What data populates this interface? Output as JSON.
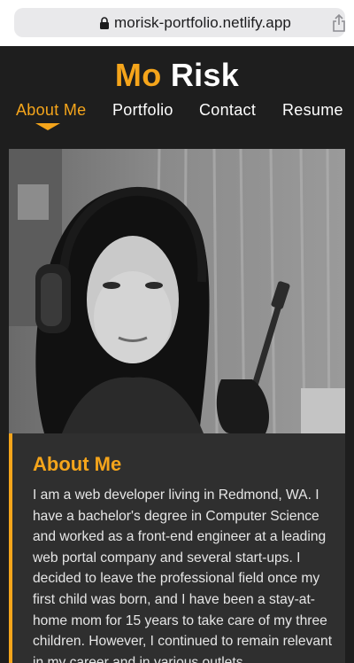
{
  "browser": {
    "url": "morisk-portfolio.netlify.app",
    "icons": [
      "lock-icon",
      "share-icon"
    ]
  },
  "site": {
    "title_first": "Mo",
    "title_last": "Risk",
    "accent_color": "#f5a51b",
    "background_color": "#1e1e1e"
  },
  "nav": {
    "items": [
      {
        "label": "About Me",
        "active": true
      },
      {
        "label": "Portfolio",
        "active": false
      },
      {
        "label": "Contact",
        "active": false
      },
      {
        "label": "Resume",
        "active": false
      }
    ]
  },
  "about": {
    "heading": "About Me",
    "body": "I am a web developer living in Redmond, WA. I have a bachelor's degree in Computer Science and worked as a front-end engineer at a leading web portal company and several start-ups. I decided to leave the professional field once my first child was born, and I have been a stay-at-home mom for 15 years to take care of my three children. However, I continued to remain relevant in my career and in various outlets."
  }
}
